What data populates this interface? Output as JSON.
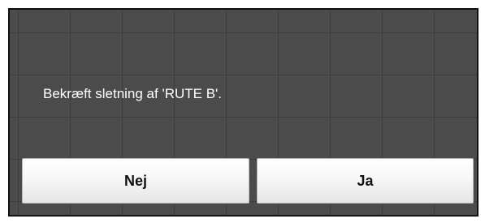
{
  "dialog": {
    "message": "Bekræft sletning af 'RUTE B'.",
    "no_label": "Nej",
    "yes_label": "Ja"
  }
}
